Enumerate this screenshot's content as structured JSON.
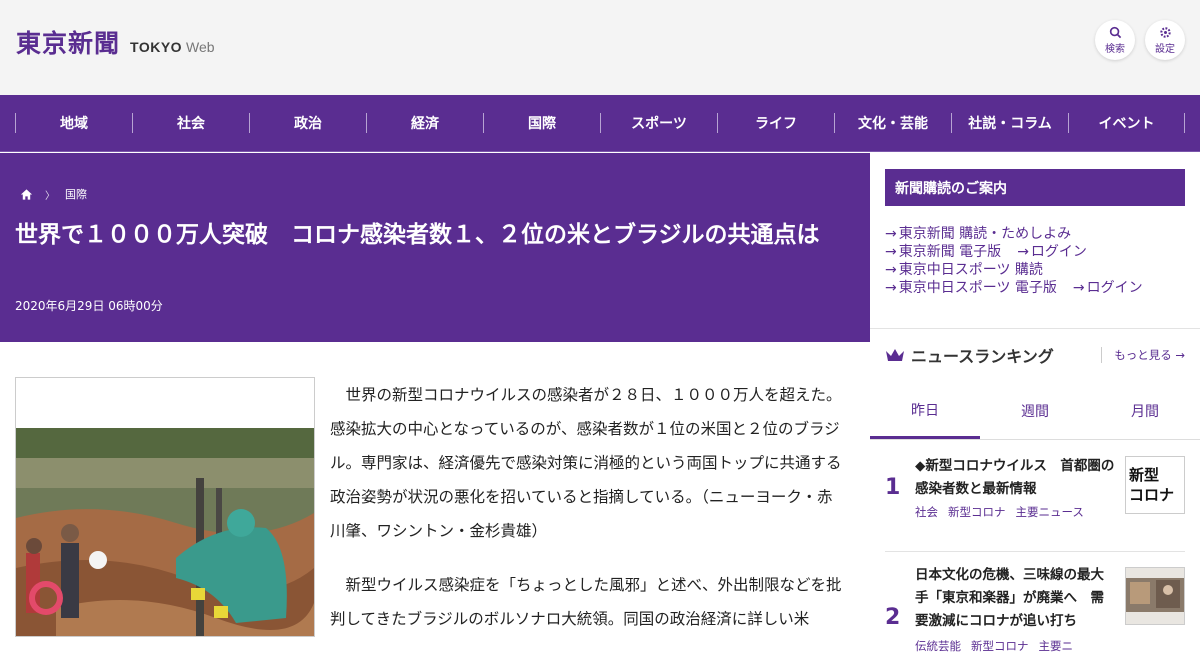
{
  "header": {
    "logo_kanji": "東京新聞",
    "logo_tokyo": "TOKYO",
    "logo_web": "Web",
    "search_label": "検索",
    "settings_label": "設定"
  },
  "nav": [
    "地域",
    "社会",
    "政治",
    "経済",
    "国際",
    "スポーツ",
    "ライフ",
    "文化・芸能",
    "社説・コラム",
    "イベント"
  ],
  "article": {
    "breadcrumb_section": "国際",
    "title": "世界で１０００万人突破　コロナ感染者数１、２位の米とブラジルの共通点は",
    "date": "2020年6月29日 06時00分",
    "paragraphs": [
      "世界の新型コロナウイルスの感染者が２８日、１０００万人を超えた。感染拡大の中心となっているのが、感染者数が１位の米国と２位のブラジル。専門家は、経済優先で感染対策に消極的という両国トップに共通する政治姿勢が状況の悪化を招いていると指摘している。（ニューヨーク・赤川肇、ワシントン・金杉貴雄）",
      "新型ウイルス感染症を「ちょっとした風邪」と述べ、外出制限などを批判してきたブラジルのボルソナロ大統領。同国の政治経済に詳しい米"
    ]
  },
  "sidebar": {
    "subscription_header": "新聞購読のご案内",
    "links": [
      [
        "東京新聞 購読・ためしよみ"
      ],
      [
        "東京新聞 電子版",
        "ログイン"
      ],
      [
        "東京中日スポーツ 購読"
      ],
      [
        "東京中日スポーツ 電子版",
        "ログイン"
      ]
    ],
    "ranking_title": "ニュースランキング",
    "more_label": "もっと見る",
    "tabs": [
      "昨日",
      "週間",
      "月間"
    ],
    "ranking": [
      {
        "rank": "1",
        "title": "◆新型コロナウイルス　首都圏の感染者数と最新情報",
        "tags": [
          "社会",
          "新型コロナ",
          "主要ニュース"
        ],
        "thumb_text": "新型\nコロナ"
      },
      {
        "rank": "2",
        "title": "日本文化の危機、三味線の最大手「東京和楽器」が廃業へ　需要激減にコロナが追い打ち",
        "tags": [
          "伝統芸能",
          "新型コロナ",
          "主要ニ"
        ]
      }
    ]
  },
  "colors": {
    "brand": "#5a2d91",
    "header_bg": "#f4f4f4"
  }
}
